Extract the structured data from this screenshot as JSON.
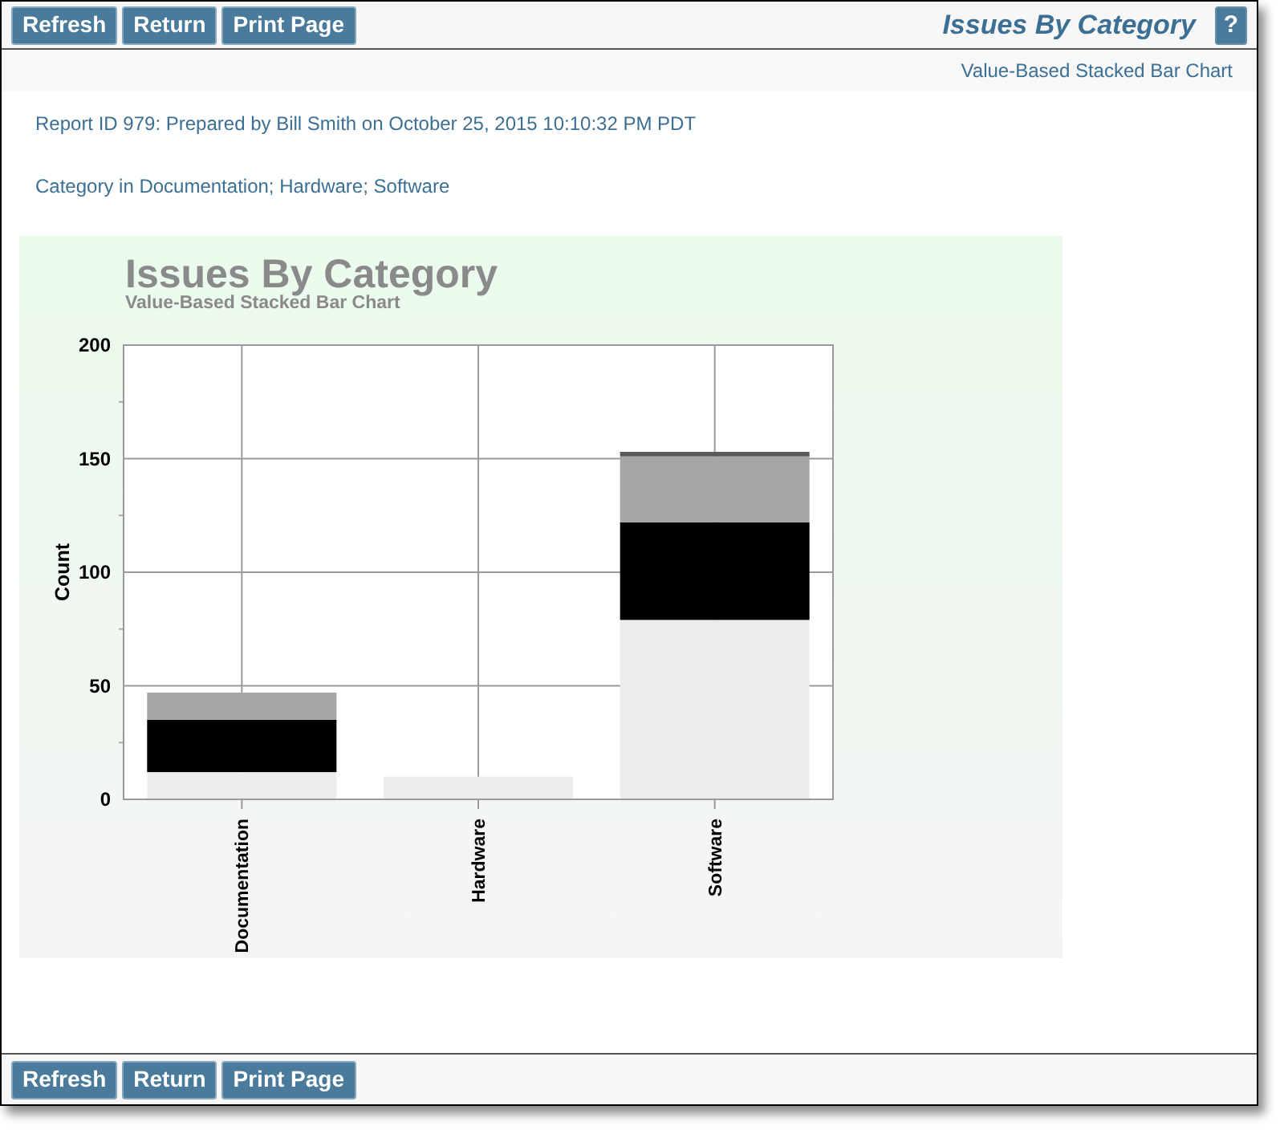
{
  "toolbar_top": {
    "buttons": [
      "Refresh",
      "Return",
      "Print Page"
    ],
    "title": "Issues By Category",
    "help": "?"
  },
  "subtitle": "Value-Based Stacked Bar Chart",
  "report_info": "Report ID 979: Prepared by Bill Smith on October 25, 2015 10:10:32 PM PDT",
  "filter": "Category in Documentation; Hardware; Software",
  "chart": {
    "chart_data": {
      "type": "bar",
      "title": "Issues By Category",
      "subtitle": "Value-Based Stacked Bar Chart",
      "ylabel": "Count",
      "stacked": true,
      "grid": true,
      "categories": [
        "Documentation",
        "Hardware",
        "Software"
      ],
      "series": [
        {
          "color": "#ececec",
          "values": [
            12,
            10,
            79
          ]
        },
        {
          "color": "#000000",
          "values": [
            23,
            null,
            43
          ]
        },
        {
          "color": "#a6a6a6",
          "values": [
            12,
            null,
            29
          ]
        },
        {
          "color": "#595959",
          "values": [
            null,
            null,
            2
          ]
        }
      ],
      "ylim": [
        0,
        200
      ],
      "yticks": [
        0,
        50,
        100,
        150,
        200
      ]
    }
  },
  "toolbar_bottom": {
    "buttons": [
      "Refresh",
      "Return",
      "Print Page"
    ]
  }
}
